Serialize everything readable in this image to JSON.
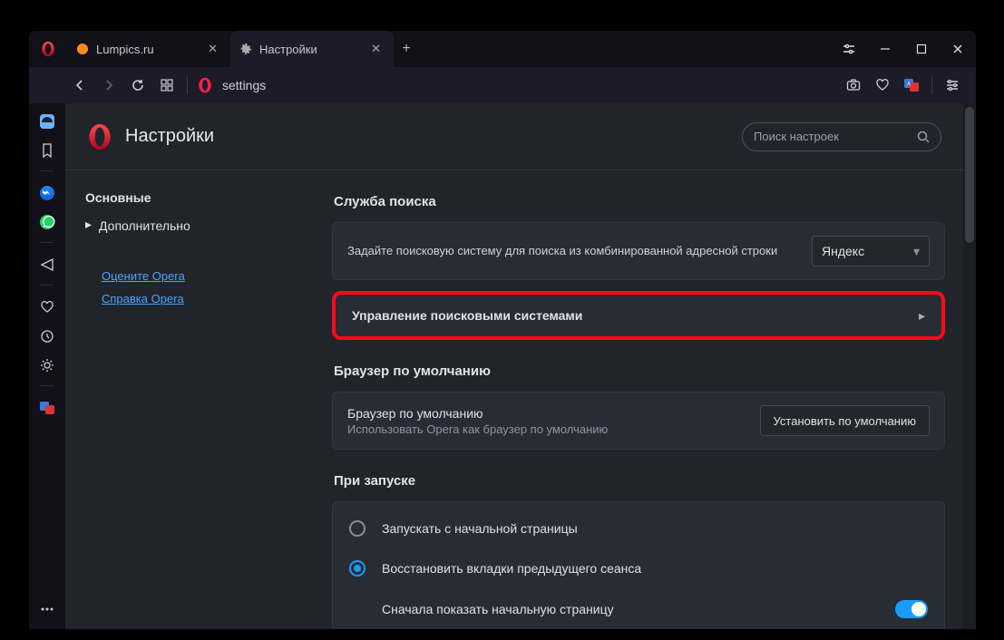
{
  "tabs": [
    {
      "label": "Lumpics.ru",
      "active": false
    },
    {
      "label": "Настройки",
      "active": true
    }
  ],
  "urlbar": {
    "text": "settings"
  },
  "page_title": "Настройки",
  "search": {
    "placeholder": "Поиск настроек"
  },
  "nav": {
    "basic": "Основные",
    "advanced": "Дополнительно",
    "rate_link": "Оцените Opera",
    "help_link": "Справка Opera"
  },
  "search_service": {
    "title": "Служба поиска",
    "desc": "Задайте поисковую систему для поиска из комбинированной адресной строки",
    "selected": "Яндекс",
    "manage": "Управление поисковыми системами"
  },
  "default_browser": {
    "title": "Браузер по умолчанию",
    "label": "Браузер по умолчанию",
    "sub": "Использовать Opera как браузер по умолчанию",
    "button": "Установить по умолчанию"
  },
  "startup": {
    "title": "При запуске",
    "opt_home": "Запускать с начальной страницы",
    "opt_restore": "Восстановить вкладки предыдущего сеанса",
    "show_home_first": "Сначала показать начальную страницу"
  }
}
